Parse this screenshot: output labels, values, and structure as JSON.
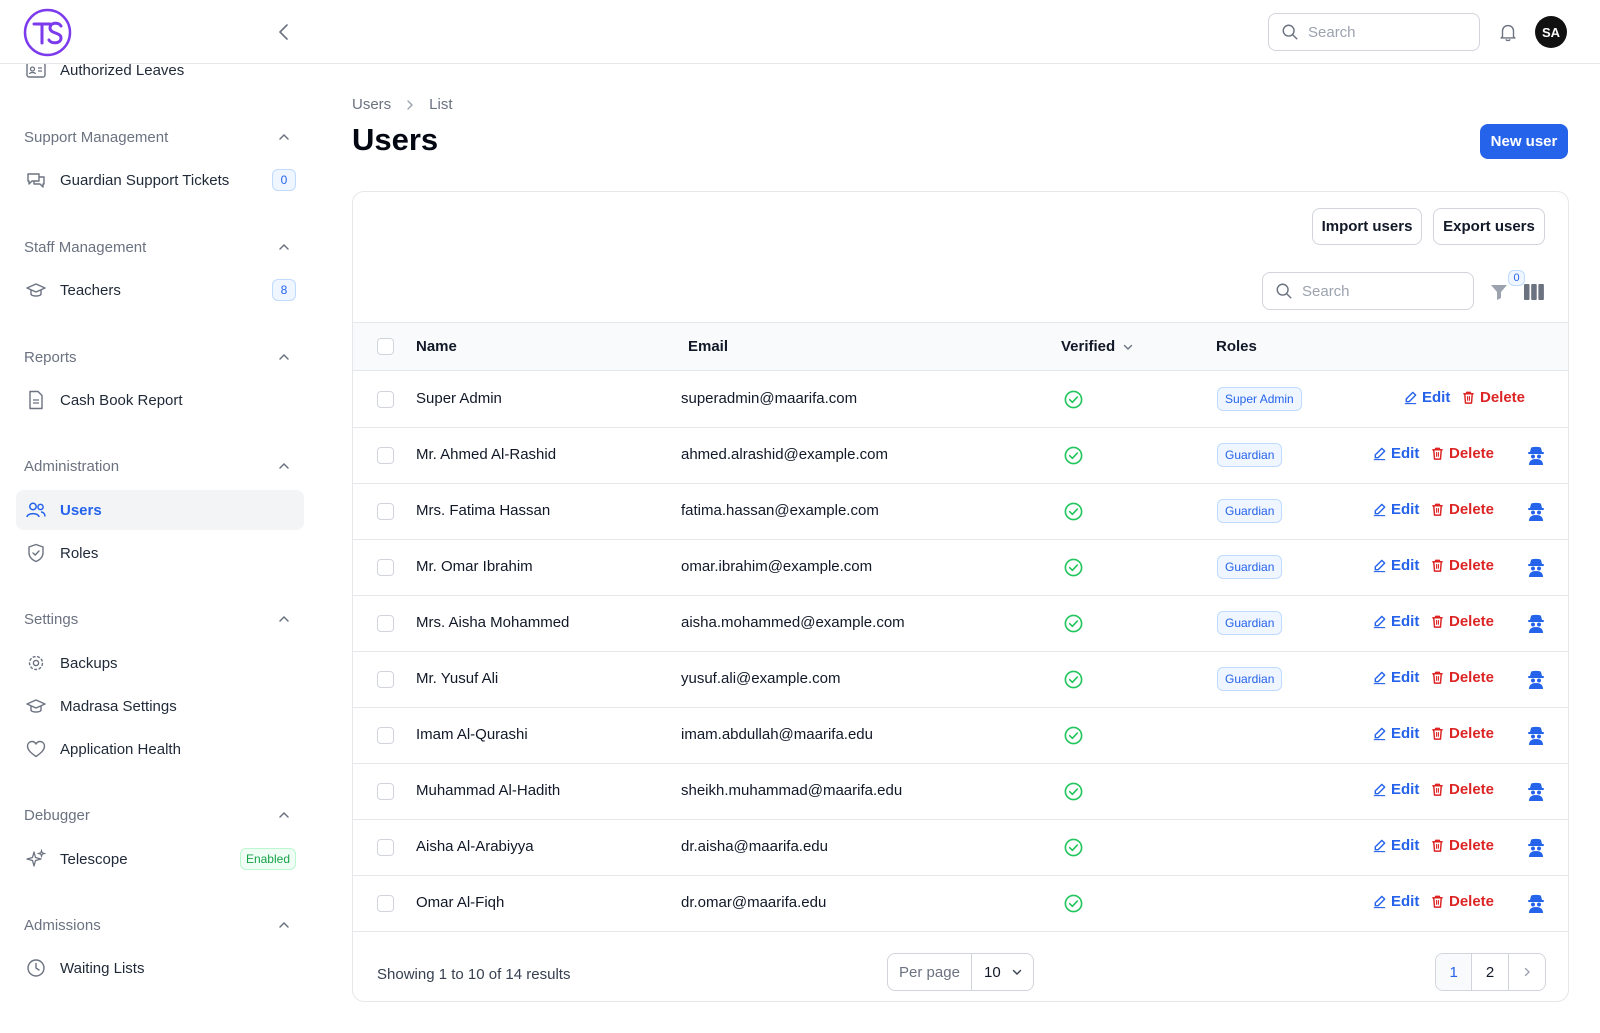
{
  "header": {
    "search_placeholder": "Search",
    "avatar_initials": "SA"
  },
  "sidebar": {
    "top_item": "Authorized Leaves",
    "groups": [
      {
        "label": "Support Management",
        "items": [
          {
            "label": "Guardian Support Tickets",
            "badge": "0"
          }
        ]
      },
      {
        "label": "Staff Management",
        "items": [
          {
            "label": "Teachers",
            "badge": "8"
          }
        ]
      },
      {
        "label": "Reports",
        "items": [
          {
            "label": "Cash Book Report"
          }
        ]
      },
      {
        "label": "Administration",
        "items": [
          {
            "label": "Users"
          },
          {
            "label": "Roles"
          }
        ]
      },
      {
        "label": "Settings",
        "items": [
          {
            "label": "Backups"
          },
          {
            "label": "Madrasa Settings"
          },
          {
            "label": "Application Health"
          }
        ]
      },
      {
        "label": "Debugger",
        "items": [
          {
            "label": "Telescope",
            "badge": "Enabled"
          }
        ]
      },
      {
        "label": "Admissions",
        "items": [
          {
            "label": "Waiting Lists"
          }
        ]
      }
    ]
  },
  "breadcrumb": [
    "Users",
    "List"
  ],
  "page": {
    "title": "Users",
    "new_button": "New user",
    "import_button": "Import users",
    "export_button": "Export users",
    "search_placeholder": "Search",
    "filter_count": "0"
  },
  "table": {
    "columns": [
      "Name",
      "Email",
      "Verified",
      "Roles"
    ],
    "edit_label": "Edit",
    "delete_label": "Delete",
    "rows": [
      {
        "name": "Super Admin",
        "email": "superadmin@maarifa.com",
        "role": "Super Admin"
      },
      {
        "name": "Mr. Ahmed Al-Rashid",
        "email": "ahmed.alrashid@example.com",
        "role": "Guardian"
      },
      {
        "name": "Mrs. Fatima Hassan",
        "email": "fatima.hassan@example.com",
        "role": "Guardian"
      },
      {
        "name": "Mr. Omar Ibrahim",
        "email": "omar.ibrahim@example.com",
        "role": "Guardian"
      },
      {
        "name": "Mrs. Aisha Mohammed",
        "email": "aisha.mohammed@example.com",
        "role": "Guardian"
      },
      {
        "name": "Mr. Yusuf Ali",
        "email": "yusuf.ali@example.com",
        "role": "Guardian"
      },
      {
        "name": "Imam Al-Qurashi",
        "email": "imam.abdullah@maarifa.edu",
        "role": ""
      },
      {
        "name": "Muhammad Al-Hadith",
        "email": "sheikh.muhammad@maarifa.edu",
        "role": ""
      },
      {
        "name": "Aisha Al-Arabiyya",
        "email": "dr.aisha@maarifa.edu",
        "role": ""
      },
      {
        "name": "Omar Al-Fiqh",
        "email": "dr.omar@maarifa.edu",
        "role": ""
      }
    ]
  },
  "pagination": {
    "summary": "Showing 1 to 10 of 14 results",
    "per_page_label": "Per page",
    "per_page_value": "10",
    "pages": [
      "1",
      "2"
    ]
  },
  "colors": {
    "accent": "#2563eb",
    "danger": "#dc2626",
    "success": "#22c55e",
    "logo": "#7c3aed"
  }
}
